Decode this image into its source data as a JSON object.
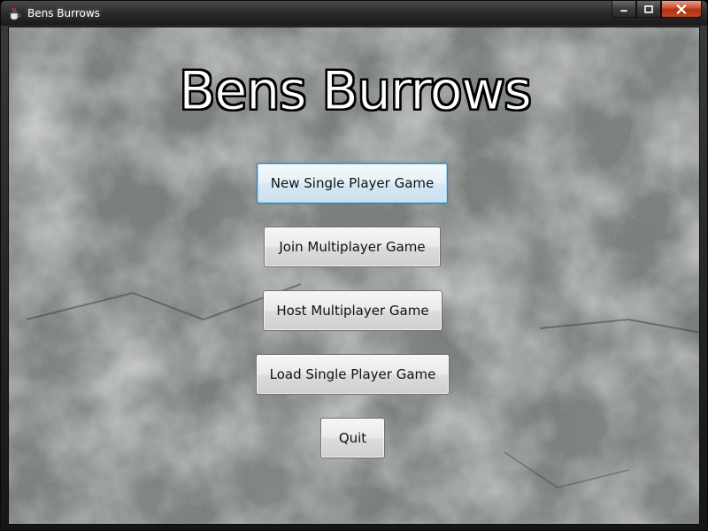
{
  "window": {
    "title": "Bens Burrows",
    "icon": "java-cup-icon",
    "controls": [
      "minimize-icon",
      "maximize-icon",
      "close-icon"
    ]
  },
  "main": {
    "heading": "Bens Burrows",
    "background": "granite-rock-texture",
    "buttons": {
      "new_single": "New Single Player Game",
      "join_multi": "Join Multiplayer Game",
      "host_multi": "Host Multiplayer Game",
      "load_single": "Load Single Player Game",
      "quit": "Quit"
    },
    "focused_button": "new_single"
  },
  "colors": {
    "focus_border": "#3c7fb1",
    "close_button": "#c75030",
    "title_text": "#ffffff"
  }
}
